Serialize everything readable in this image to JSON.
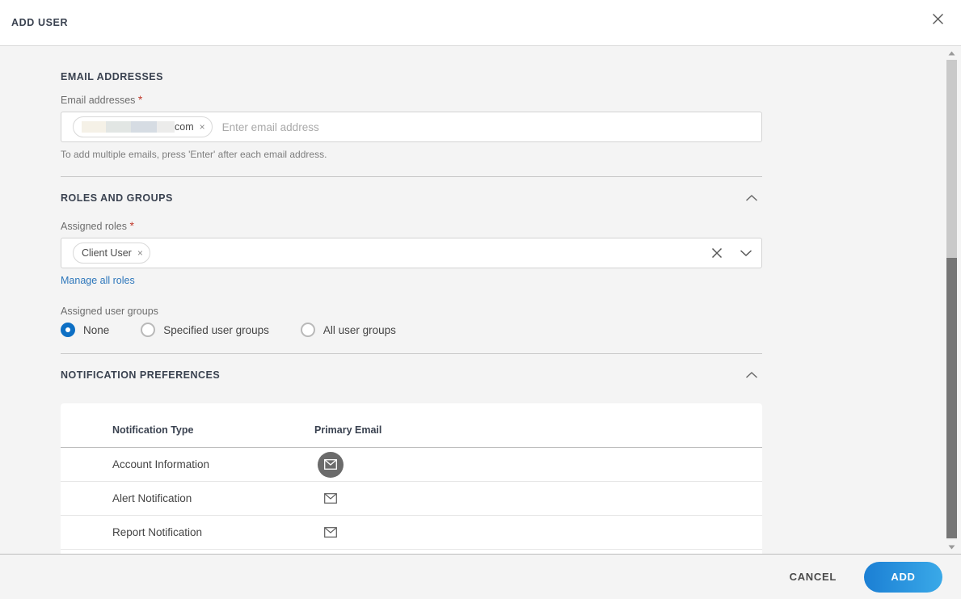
{
  "dialog": {
    "title": "ADD USER",
    "close_icon": "close-icon"
  },
  "sections": {
    "email": {
      "heading": "EMAIL ADDRESSES",
      "field_label": "Email addresses",
      "required_mark": "*",
      "chip_suffix": "com",
      "chip_remove_icon": "×",
      "input_placeholder": "Enter email address",
      "input_value": "",
      "hint": "To add multiple emails, press 'Enter' after each email address.",
      "redacted_blocks": [
        "#f5f1e7",
        "#e2e6e4",
        "#d6dce3",
        "#ececeb"
      ]
    },
    "roles": {
      "heading": "ROLES AND GROUPS",
      "collapse_icon": "chevron-up-icon",
      "field_label": "Assigned roles",
      "required_mark": "*",
      "chips": [
        "Client User"
      ],
      "chip_remove_icon": "×",
      "clear_icon": "close-icon",
      "dropdown_icon": "chevron-down-icon",
      "manage_link": "Manage all roles",
      "groups_label": "Assigned user groups",
      "group_options": [
        {
          "label": "None",
          "selected": true
        },
        {
          "label": "Specified user groups",
          "selected": false
        },
        {
          "label": "All user groups",
          "selected": false
        }
      ]
    },
    "notifications": {
      "heading": "NOTIFICATION PREFERENCES",
      "collapse_icon": "chevron-up-icon",
      "columns": [
        "Notification Type",
        "Primary Email"
      ],
      "rows": [
        {
          "type": "Account Information",
          "email_icon": "envelope-icon",
          "active": true
        },
        {
          "type": "Alert Notification",
          "email_icon": "envelope-icon",
          "active": false
        },
        {
          "type": "Report Notification",
          "email_icon": "envelope-icon",
          "active": false
        }
      ]
    }
  },
  "scrollbar": {
    "up_icon": "triangle-up-icon",
    "down_icon": "triangle-down-icon"
  },
  "footer": {
    "cancel_label": "CANCEL",
    "add_label": "ADD"
  },
  "colors": {
    "accent": "#0d6fc4",
    "link": "#2e77bb",
    "required": "#c0392b",
    "add_button_from": "#1b7fd4",
    "add_button_to": "#3aa9e8"
  }
}
